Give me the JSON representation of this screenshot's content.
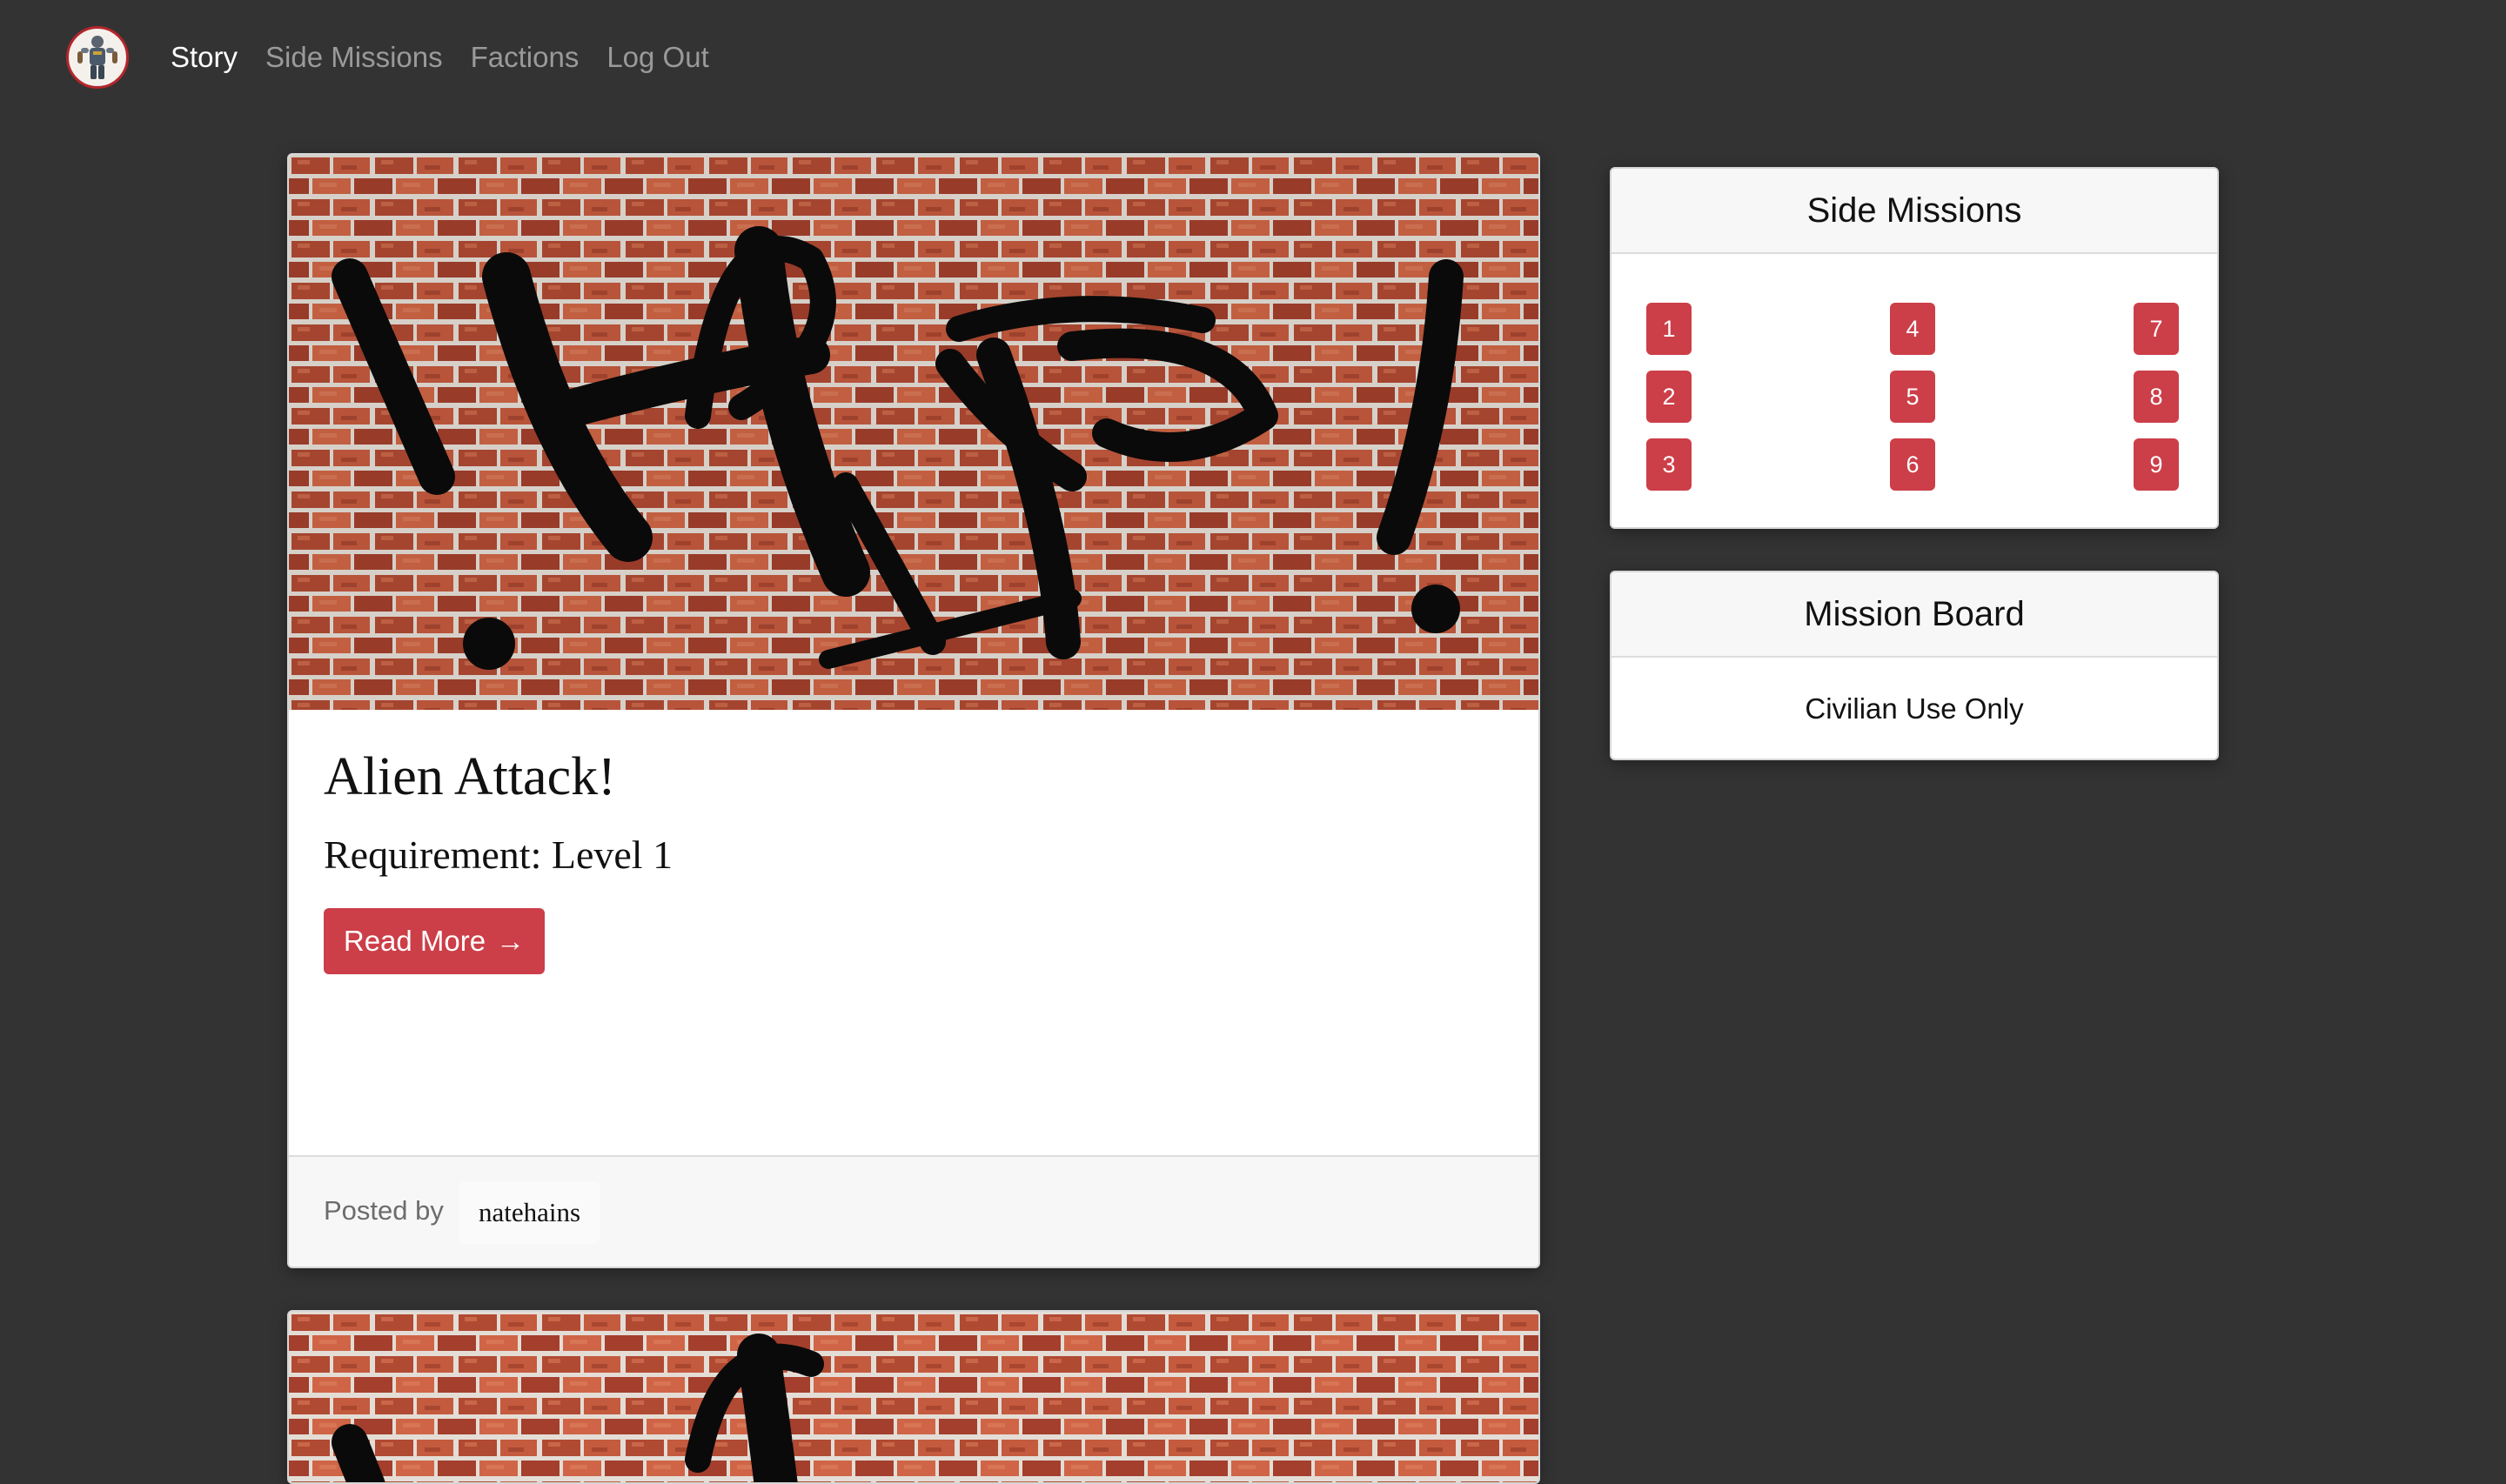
{
  "nav": {
    "logo_icon": "hero-logo-icon",
    "links": [
      {
        "label": "Story",
        "active": true
      },
      {
        "label": "Side Missions",
        "active": false
      },
      {
        "label": "Factions",
        "active": false
      },
      {
        "label": "Log Out",
        "active": false
      }
    ]
  },
  "posts": [
    {
      "image_icon": "help-graffiti-brick-wall-image",
      "title": "Alien Attack!",
      "requirement": "Requirement: Level 1",
      "read_more_label": "Read More",
      "read_more_arrow": "→",
      "posted_by_label": "Posted by",
      "author": "natehains"
    },
    {
      "image_icon": "help-graffiti-brick-wall-image"
    }
  ],
  "side_missions": {
    "title": "Side Missions",
    "buttons": [
      "1",
      "4",
      "7",
      "2",
      "5",
      "8",
      "3",
      "6",
      "9"
    ]
  },
  "mission_board": {
    "title": "Mission Board",
    "text": "Civilian Use Only"
  },
  "colors": {
    "background": "#333333",
    "accent_red": "#cc3e48",
    "nav_active": "#ffffff",
    "nav_inactive": "#9a9a9a"
  }
}
